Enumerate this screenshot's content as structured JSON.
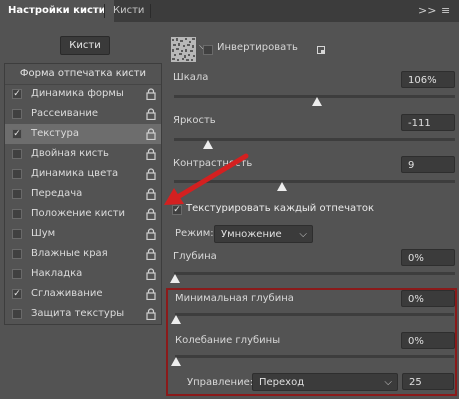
{
  "tabs": {
    "brush_settings": "Настройки кисти",
    "brushes": "Кисти",
    "menu_arrows": ">>",
    "menu_icon": "≡"
  },
  "left": {
    "brushes_button": "Кисти",
    "header": "Форма отпечатка кисти",
    "items": [
      {
        "label": "Динамика формы",
        "checked": true,
        "lock": true
      },
      {
        "label": "Рассеивание",
        "checked": false,
        "lock": true
      },
      {
        "label": "Текстура",
        "checked": true,
        "lock": true,
        "selected": true
      },
      {
        "label": "Двойная кисть",
        "checked": false,
        "lock": true
      },
      {
        "label": "Динамика цвета",
        "checked": false,
        "lock": true
      },
      {
        "label": "Передача",
        "checked": false,
        "lock": true
      },
      {
        "label": "Положение кисти",
        "checked": false,
        "lock": true
      },
      {
        "label": "Шум",
        "checked": false,
        "lock": true
      },
      {
        "label": "Влажные края",
        "checked": false,
        "lock": true
      },
      {
        "label": "Накладка",
        "checked": false,
        "lock": true
      },
      {
        "label": "Сглаживание",
        "checked": true,
        "lock": true
      },
      {
        "label": "Защита текстуры",
        "checked": false,
        "lock": true
      }
    ]
  },
  "right": {
    "invert_label": "Инвертировать",
    "invert_checked": false,
    "scale": {
      "label": "Шкала",
      "value": "106%"
    },
    "brightness": {
      "label": "Яркость",
      "value": "-111"
    },
    "contrast": {
      "label": "Контрастность",
      "value": "9"
    },
    "texture_each_label": "Текстурировать каждый отпечаток",
    "texture_each_checked": true,
    "mode": {
      "label": "Режим:",
      "value": "Умножение"
    },
    "depth": {
      "label": "Глубина",
      "value": "0%"
    },
    "min_depth": {
      "label": "Минимальная глубина",
      "value": "0%"
    },
    "depth_jitter": {
      "label": "Колебание глубины",
      "value": "0%"
    },
    "control": {
      "label": "Управление:",
      "value": "Переход",
      "number": "25"
    }
  },
  "colors": {
    "highlight": "#8b1a1a",
    "arrow": "#d42020"
  },
  "icons": {
    "lock": "lock-icon",
    "new_texture": "new-texture-icon",
    "chevron": "chevron-down-icon"
  }
}
